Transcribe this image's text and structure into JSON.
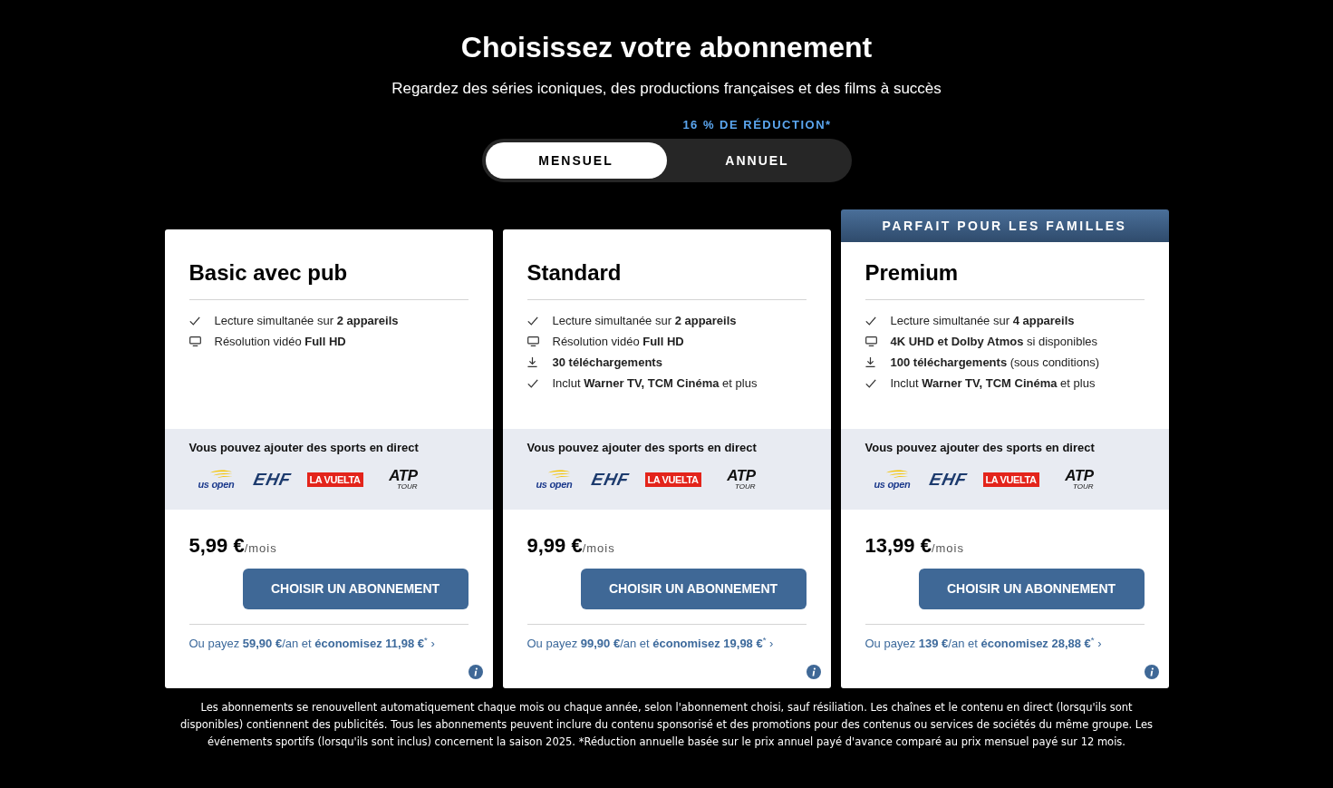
{
  "header": {
    "title": "Choisissez votre abonnement",
    "subtitle": "Regardez des séries iconiques, des productions françaises et des films à succès"
  },
  "billing_toggle": {
    "discount_note": "16 % DE RÉDUCTION*",
    "options": [
      {
        "label": "MENSUEL",
        "selected": true
      },
      {
        "label": "ANNUEL",
        "selected": false
      }
    ]
  },
  "plans": [
    {
      "name": "Basic avec pub",
      "features": [
        {
          "kind": "check",
          "text": "Lecture simultanée sur **2 appareils**"
        },
        {
          "kind": "screen",
          "text": "Résolution vidéo **Full HD**"
        }
      ],
      "sports": {
        "title": "Vous pouvez ajouter des sports en direct",
        "logos": [
          {
            "kind": "swoosh",
            "text": "us open"
          },
          {
            "kind": "slanted",
            "text": "EHF"
          },
          {
            "kind": "red-label",
            "text": "LA VUELTA"
          },
          {
            "kind": "stacked",
            "text": "ATP",
            "subtext": "TOUR"
          }
        ]
      },
      "price": "5,99 €",
      "period": "/mois",
      "button": "CHOISIR UN ABONNEMENT",
      "annual_offer": "Ou payez **59,90 €**/an et **économisez 11,98 €**$^{*}$ ›"
    },
    {
      "name": "Standard",
      "features": [
        {
          "kind": "check",
          "text": "Lecture simultanée sur **2 appareils**"
        },
        {
          "kind": "screen",
          "text": "Résolution vidéo **Full HD**"
        },
        {
          "kind": "download",
          "text": "**30 téléchargements**"
        },
        {
          "kind": "check",
          "text": "Inclut **Warner TV, TCM Cinéma** et plus"
        }
      ],
      "sports": {
        "title": "Vous pouvez ajouter des sports en direct",
        "logos": [
          {
            "kind": "swoosh",
            "text": "us open"
          },
          {
            "kind": "slanted",
            "text": "EHF"
          },
          {
            "kind": "red-label",
            "text": "LA VUELTA"
          },
          {
            "kind": "stacked",
            "text": "ATP",
            "subtext": "TOUR"
          }
        ]
      },
      "price": "9,99 €",
      "period": "/mois",
      "button": "CHOISIR UN ABONNEMENT",
      "annual_offer": "Ou payez **99,90 €**/an et **économisez 19,98 €**$^{*}$ ›"
    },
    {
      "banner": "PARFAIT POUR LES FAMILLES",
      "name": "Premium",
      "features": [
        {
          "kind": "check",
          "text": "Lecture simultanée sur **4 appareils**"
        },
        {
          "kind": "screen",
          "text": "**4K UHD et Dolby Atmos** si disponibles"
        },
        {
          "kind": "download",
          "text": "**100 téléchargements** (sous conditions)"
        },
        {
          "kind": "check",
          "text": "Inclut **Warner TV, TCM Cinéma** et plus"
        }
      ],
      "sports": {
        "title": "Vous pouvez ajouter des sports en direct",
        "logos": [
          {
            "kind": "swoosh",
            "text": "us open"
          },
          {
            "kind": "slanted",
            "text": "EHF"
          },
          {
            "kind": "red-label",
            "text": "LA VUELTA"
          },
          {
            "kind": "stacked",
            "text": "ATP",
            "subtext": "TOUR"
          }
        ]
      },
      "price": "13,99 €",
      "period": "/mois",
      "button": "CHOISIR UN ABONNEMENT",
      "annual_offer": "Ou payez **139 €**/an et **économisez 28,88 €**$^{*}$ ›"
    }
  ],
  "legal_notice": "Les abonnements se renouvellent automatiquement chaque mois ou chaque année, selon l'abonnement choisi, sauf résiliation. Les chaînes et le contenu en direct (lorsqu'ils sont disponibles) contiennent des publicités. Tous les abonnements peuvent inclure du contenu sponsorisé et des promotions pour des contenus ou services de sociétés du même groupe. Les événements sportifs (lorsqu'ils sont inclus) concernent la saison 2025. *Réduction annuelle basée sur le prix annuel payé d'avance comparé au prix mensuel payé sur 12 mois."
}
